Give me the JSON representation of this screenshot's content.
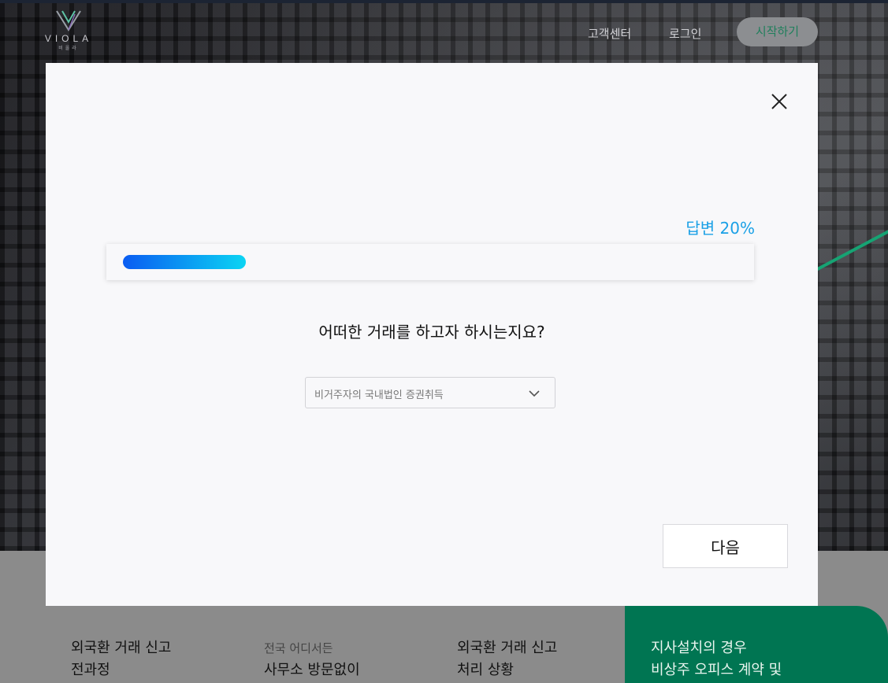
{
  "header": {
    "logo_word": "VIOLA",
    "logo_sub": "비올라",
    "nav_customer_center": "고객센터",
    "nav_login": "로그인",
    "nav_start": "시작하기"
  },
  "features": [
    {
      "line1": "외국환 거래 신고",
      "line2": "전과정"
    },
    {
      "line1": "전국 어디서든",
      "line2": "사무소 방문없이"
    },
    {
      "line1": "외국환 거래 신고",
      "line2": "처리 상황"
    },
    {
      "line1": "지사설치의 경우",
      "line2": "비상주 오피스 계약 및"
    }
  ],
  "modal": {
    "progress_label": "답변 20%",
    "progress_fraction": 0.2,
    "question": "어떠한 거래를 하고자 하시는지요?",
    "select_value": "비거주자의 국내법인 증권취득",
    "next_label": "다음"
  },
  "colors": {
    "accent_blue": "#1aa0e6",
    "progress_start": "#0a5cf2",
    "progress_end": "#0bd4f3",
    "brand_green": "#007552"
  },
  "icons": {
    "close": "close-icon",
    "chevron": "chevron-down-icon",
    "logo": "viola-logo-icon"
  }
}
